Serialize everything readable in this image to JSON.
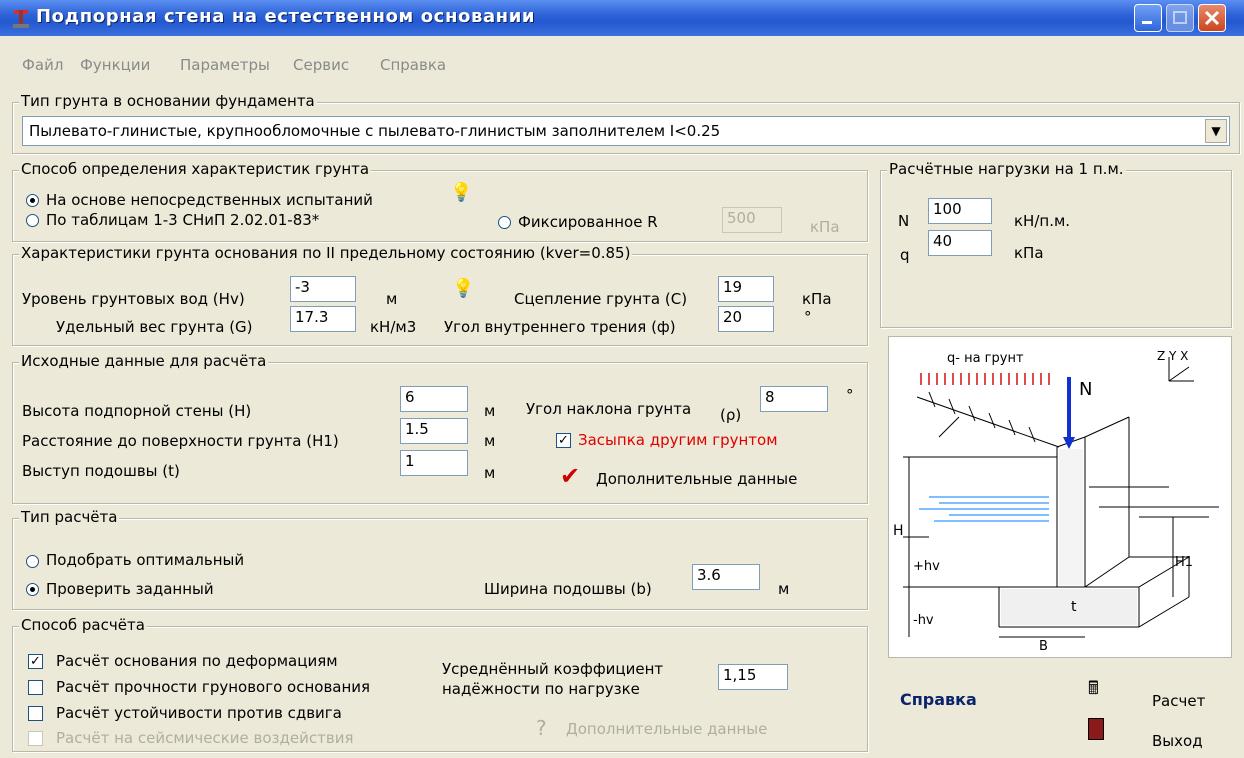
{
  "window": {
    "title": "Подпорная стена на естественном основании"
  },
  "menu": [
    "Файл",
    "Функции",
    "Параметры",
    "Сервис",
    "Справка"
  ],
  "soil_type": {
    "group_label": "Тип грунта в основании фундамента",
    "value": "Пылевато-глинистые, крупнообломочные с пылевато-глинистым заполнителем  I<0.25"
  },
  "method": {
    "group_label": "Способ определения характеристик грунта",
    "opt1": "На основе непосредственных испытаний",
    "opt2": "По таблицам 1-3 СНиП 2.02.01-83*",
    "opt3": "Фиксированное R",
    "r_value": "500",
    "r_unit": "кПа"
  },
  "soil_props": {
    "group_label": "Характеристики грунта основания по II предельному состоянию (kver=0.85)",
    "hv_label": "Уровень грунтовых вод (Hv)",
    "hv_value": "-3",
    "hv_unit": "м",
    "g_label": "Удельный вес грунта (G)",
    "g_value": "17.3",
    "g_unit": "кН/м3",
    "c_label": "Сцепление грунта (C)",
    "c_value": "19",
    "c_unit": "кПа",
    "phi_label": "Угол внутреннего трения (ф)",
    "phi_value": "20",
    "phi_unit": "°"
  },
  "input_data": {
    "group_label": "Исходные данные для расчёта",
    "h_label": "Высота подпорной стены (H)",
    "h_value": "6",
    "h_unit": "м",
    "h1_label": "Расстояние до поверхности грунта (H1)",
    "h1_value": "1.5",
    "h1_unit": "м",
    "t_label": "Выступ подошвы (t)",
    "t_value": "1",
    "t_unit": "м",
    "rho_label": "Угол наклона грунта",
    "rho_sym": "(ρ)",
    "rho_value": "8",
    "rho_unit": "°",
    "backfill_label": "Засыпка другим грунтом",
    "extra_label": "Дополнительные данные"
  },
  "calc_type": {
    "group_label": "Тип расчёта",
    "opt1": "Подобрать оптимальный",
    "opt2": "Проверить заданный",
    "b_label": "Ширина подошвы (b)",
    "b_value": "3.6",
    "b_unit": "м"
  },
  "calc_method": {
    "group_label": "Способ расчёта",
    "c1": "Расчёт основания по деформациям",
    "c2": "Расчёт прочности грунового основания",
    "c3": "Расчёт устойчивости против сдвига",
    "c4": "Расчёт на сейсмические воздействия",
    "coef_label1": "Усреднённый коэффициент",
    "coef_label2": "надёжности по нагрузке",
    "coef_value": "1,15",
    "extra_label": "Дополнительные данные"
  },
  "loads": {
    "group_label": "Расчётные нагрузки на 1 п.м.",
    "n_label": "N",
    "n_value": "100",
    "n_unit": "кН/п.м.",
    "q_label": "q",
    "q_value": "40",
    "q_unit": "кПа"
  },
  "diagram": {
    "q_text": "q- на грунт",
    "n_text": "N",
    "h_text": "H",
    "hv_plus": "+hv",
    "hv_minus": "-hv",
    "h1_text": "H1",
    "t_text": "t",
    "b_text": "B",
    "axes": "Z Y X"
  },
  "actions": {
    "help": "Справка",
    "calc": "Расчет",
    "exit": "Выход"
  }
}
